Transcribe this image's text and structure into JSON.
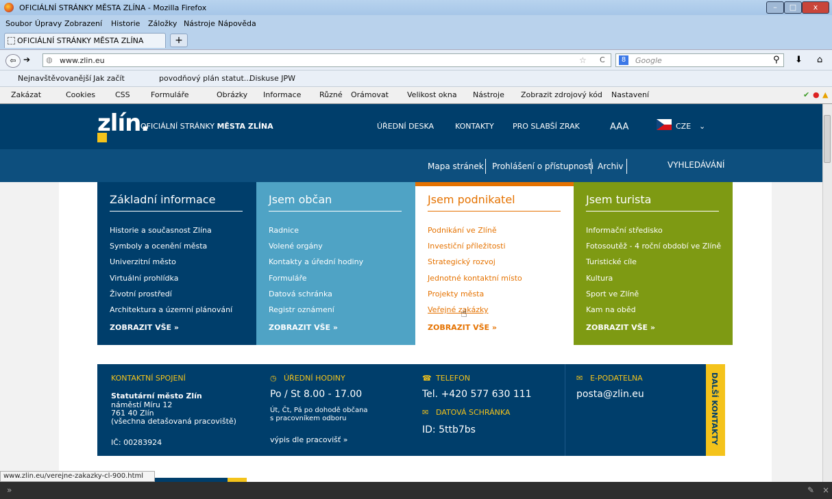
{
  "window": {
    "title": "OFICIÁLNÍ STRÁNKY MĚSTA ZLÍNA - Mozilla Firefox"
  },
  "menu": [
    "Soubor",
    "Úpravy",
    "Zobrazení",
    "Historie",
    "Záložky",
    "Nástroje",
    "Nápověda"
  ],
  "tab": {
    "label": "OFICIÁLNÍ STRÁNKY MĚSTA ZLÍNA"
  },
  "nav": {
    "url": "www.zlin.eu",
    "search_placeholder": "Google"
  },
  "bookmarks": [
    "Nejnavštěvovanější",
    "Jak začít",
    "povodňový plán statut...",
    "Diskuse JPW"
  ],
  "webdev": [
    "Zakázat",
    "Cookies",
    "CSS",
    "Formuláře",
    "Obrázky",
    "Informace",
    "Různé",
    "Orámovat",
    "Velikost okna",
    "Nástroje",
    "Zobrazit zdrojový kód",
    "Nastavení"
  ],
  "site": {
    "logo": "zlín.",
    "subtitle": "OFICIÁLNÍ STRÁNKY ",
    "subtitle_bold": "MĚSTA ZLÍNA",
    "top_links": [
      "ÚŘEDNÍ DESKA",
      "KONTAKTY",
      "PRO SLABŠÍ ZRAK"
    ],
    "font_size": "AAA",
    "lang": "CZE",
    "sub_links": [
      "Mapa stránek",
      "Prohlášení o přístupnosti",
      "Archiv"
    ],
    "search": "VYHLEDÁVÁNÍ",
    "columns": [
      {
        "title": "Základní informace",
        "items": [
          "Historie a současnost Zlína",
          "Symboly a ocenění města",
          "Univerzitní město",
          "Virtuální prohlídka",
          "Životní prostředí",
          "Architektura a územní plánování"
        ],
        "all": "ZOBRAZIT VŠE »"
      },
      {
        "title": "Jsem občan",
        "items": [
          "Radnice",
          "Volené orgány",
          "Kontakty a úřední hodiny",
          "Formuláře",
          "Datová schránka",
          "Registr oznámení"
        ],
        "all": "ZOBRAZIT VŠE »"
      },
      {
        "title": "Jsem podnikatel",
        "items": [
          "Podnikání ve Zlíně",
          "Investiční příležitosti",
          "Strategický rozvoj",
          "Jednotné kontaktní místo",
          "Projekty města",
          "Veřejné zakázky"
        ],
        "all": "ZOBRAZIT VŠE »"
      },
      {
        "title": "Jsem turista",
        "items": [
          "Informační středisko",
          "Fotosoutěž - 4 roční období ve Zlíně",
          "Turistické cíle",
          "Kultura",
          "Sport ve Zlíně",
          "Kam na oběd"
        ],
        "all": "ZOBRAZIT VŠE »"
      }
    ],
    "contacts": {
      "spojeni": {
        "heading": "KONTAKTNÍ SPOJENÍ",
        "name": "Statutární město Zlín",
        "street": "náměstí Míru 12",
        "city": "761 40 Zlín",
        "note": "(všechna detašovaná pracoviště)",
        "ic": "IČ: 00283924"
      },
      "hodiny": {
        "heading": "ÚŘEDNÍ HODINY",
        "main": "Po / St 8.00 - 17.00",
        "line1": "Út, Čt, Pá po dohodě občana",
        "line2": "s pracovníkem odboru",
        "link": "výpis dle pracovišť »"
      },
      "telefon": {
        "heading": "TELEFON",
        "number": "Tel. +420 577 630 111",
        "ds_heading": "DATOVÁ SCHRÁNKA",
        "ds_id": "ID: 5ttb7bs"
      },
      "podatelna": {
        "heading": "E-PODATELNA",
        "email": "posta@zlin.eu"
      },
      "more": "DALŠÍ KONTAKTY"
    }
  },
  "status": {
    "url": "www.zlin.eu/verejne-zakazky-cl-900.html"
  }
}
